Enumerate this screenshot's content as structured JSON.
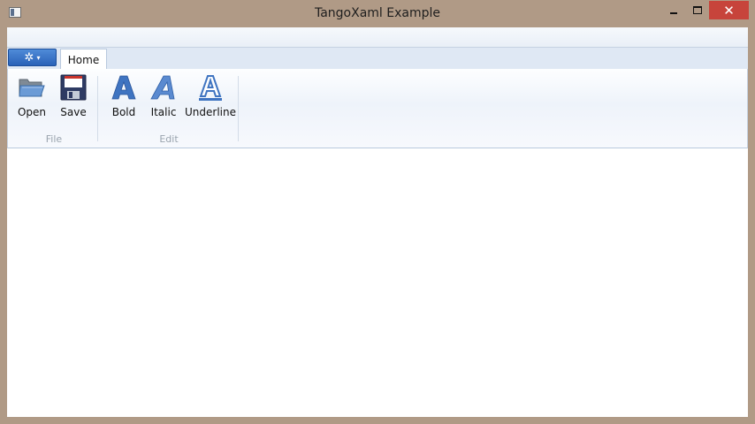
{
  "window": {
    "title": "TangoXaml Example",
    "icons": {
      "app": "app-window-icon",
      "minimize": "minimize-icon",
      "maximize": "maximize-icon",
      "close": "close-icon"
    },
    "close_glyph": "✕"
  },
  "ribbon": {
    "app_menu": {
      "icon": "gear-icon",
      "glyph": "✲",
      "caret": "▾"
    },
    "tabs": [
      {
        "label": "Home"
      }
    ],
    "groups": [
      {
        "label": "File",
        "buttons": [
          {
            "label": "Open",
            "icon": "folder-open-icon"
          },
          {
            "label": "Save",
            "icon": "floppy-disk-icon"
          }
        ]
      },
      {
        "label": "Edit",
        "buttons": [
          {
            "label": "Bold",
            "icon": "bold-icon"
          },
          {
            "label": "Italic",
            "icon": "italic-icon"
          },
          {
            "label": "Underline",
            "icon": "underline-icon"
          }
        ]
      }
    ]
  },
  "colors": {
    "accent": "#2a62b8",
    "close_button": "#c7443b",
    "border": "#b09a86"
  }
}
